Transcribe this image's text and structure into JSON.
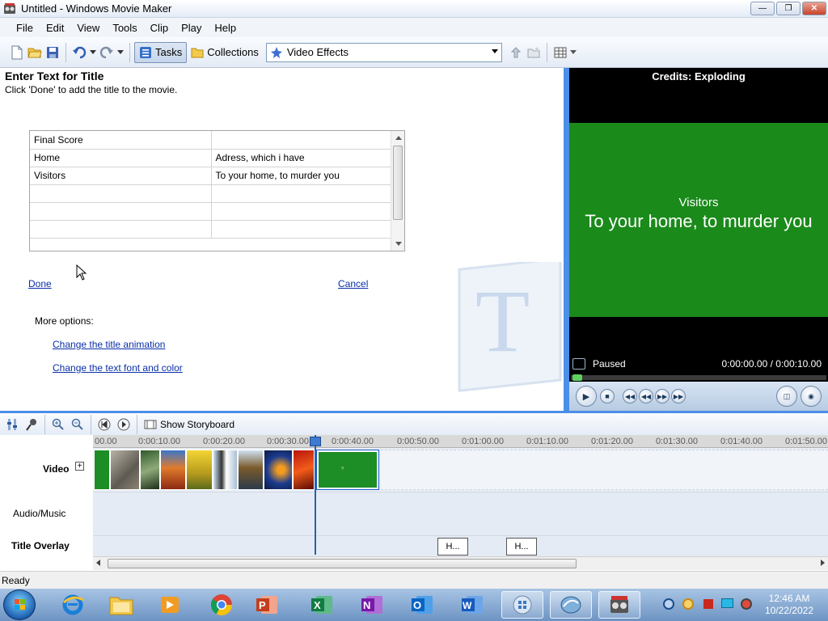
{
  "window": {
    "title": "Untitled - Windows Movie Maker"
  },
  "menu": [
    "File",
    "Edit",
    "View",
    "Tools",
    "Clip",
    "Play",
    "Help"
  ],
  "toolbar": {
    "tasks_label": "Tasks",
    "collections_label": "Collections",
    "effects_select": "Video Effects"
  },
  "task": {
    "heading": "Enter Text for Title",
    "instructions": "Click 'Done' to add the title to the movie.",
    "grid": [
      [
        "Final Score",
        ""
      ],
      [
        "Home",
        "Adress, which i have"
      ],
      [
        "Visitors",
        "To your home, to murder you"
      ],
      [
        "",
        ""
      ],
      [
        "",
        ""
      ],
      [
        "",
        ""
      ]
    ],
    "done": "Done",
    "cancel": "Cancel",
    "more_options": "More options:",
    "change_animation": "Change the title animation",
    "change_font": "Change the text font and color"
  },
  "preview": {
    "title": "Credits: Exploding",
    "caption_small": "Visitors",
    "caption_large": "To your home, to murder you",
    "state": "Paused",
    "time": "0:00:00.00 / 0:00:10.00",
    "screen_color": "#1a8a1a"
  },
  "timeline": {
    "show_storyboard": "Show Storyboard",
    "tracks": {
      "video": "Video",
      "audio": "Audio/Music",
      "title": "Title Overlay"
    },
    "ruler": [
      "00.00",
      "0:00:10.00",
      "0:00:20.00",
      "0:00:30.00",
      "0:00:40.00",
      "0:00:50.00",
      "0:01:00.00",
      "0:01:10.00",
      "0:01:20.00",
      "0:01:30.00",
      "0:01:40.00",
      "0:01:50.00"
    ],
    "title_clips": [
      "H...",
      "H..."
    ]
  },
  "status": "Ready",
  "clock": {
    "time": "12:46 AM",
    "date": "10/22/2022"
  }
}
